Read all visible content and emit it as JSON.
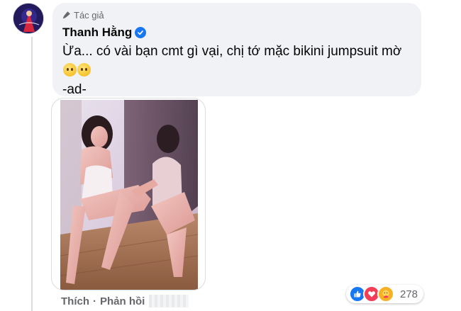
{
  "comment": {
    "badge_label": "Tác giả",
    "author_name": "Thanh Hằng",
    "text": "Ừa... có vài bạn cmt gì vại, chị tớ mặc bikini jumpsuit mờ",
    "signature": "-ad-",
    "emoji_names": [
      "hushed-face-emoji",
      "hushed-face-emoji"
    ]
  },
  "actions": {
    "like_label": "Thích",
    "separator": "·",
    "reply_label": "Phản hồi"
  },
  "reactions": {
    "icons": [
      "like-icon",
      "love-icon",
      "care-icon"
    ],
    "count": "278"
  },
  "colors": {
    "bubble_bg": "#f0f2f5",
    "verified": "#1877f2",
    "like": "#1877f2",
    "love": "#f33e58",
    "care": "#f7b125",
    "secondary_text": "#65676b"
  }
}
